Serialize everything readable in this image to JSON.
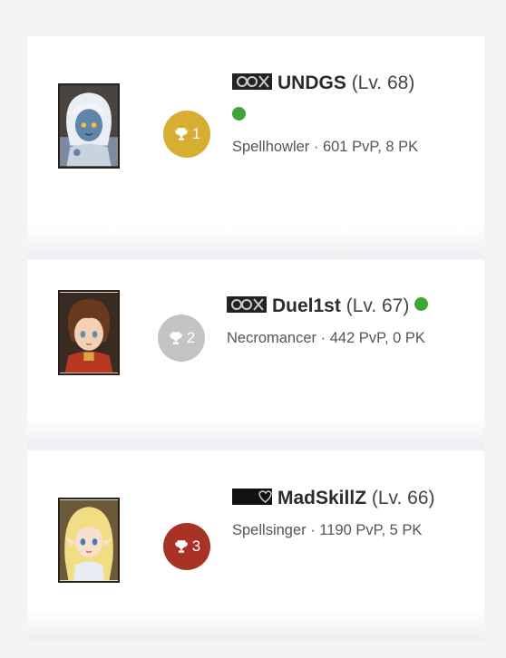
{
  "players": [
    {
      "rank": "1",
      "name": "UNDGS",
      "level": "(Lv. 68)",
      "online": true,
      "meta": "Spellhowler · 601 PvP, 8 PK",
      "badge_color": "#d7ad32",
      "avatar": "white-haired-dark-elf-avatar"
    },
    {
      "rank": "2",
      "name": "Duel1st",
      "level": "(Lv. 67)",
      "online": true,
      "meta": "Necromancer · 442 PvP, 0 PK",
      "badge_color": "#c4c4c4",
      "avatar": "brown-haired-human-avatar"
    },
    {
      "rank": "3",
      "name": "MadSkillZ",
      "level": "(Lv. 66)",
      "online": false,
      "meta": "Spellsinger · 1190 PvP, 5 PK",
      "badge_color": "#a83226",
      "avatar": "blonde-elf-avatar"
    }
  ],
  "colors": {
    "online": "#3fa535"
  }
}
